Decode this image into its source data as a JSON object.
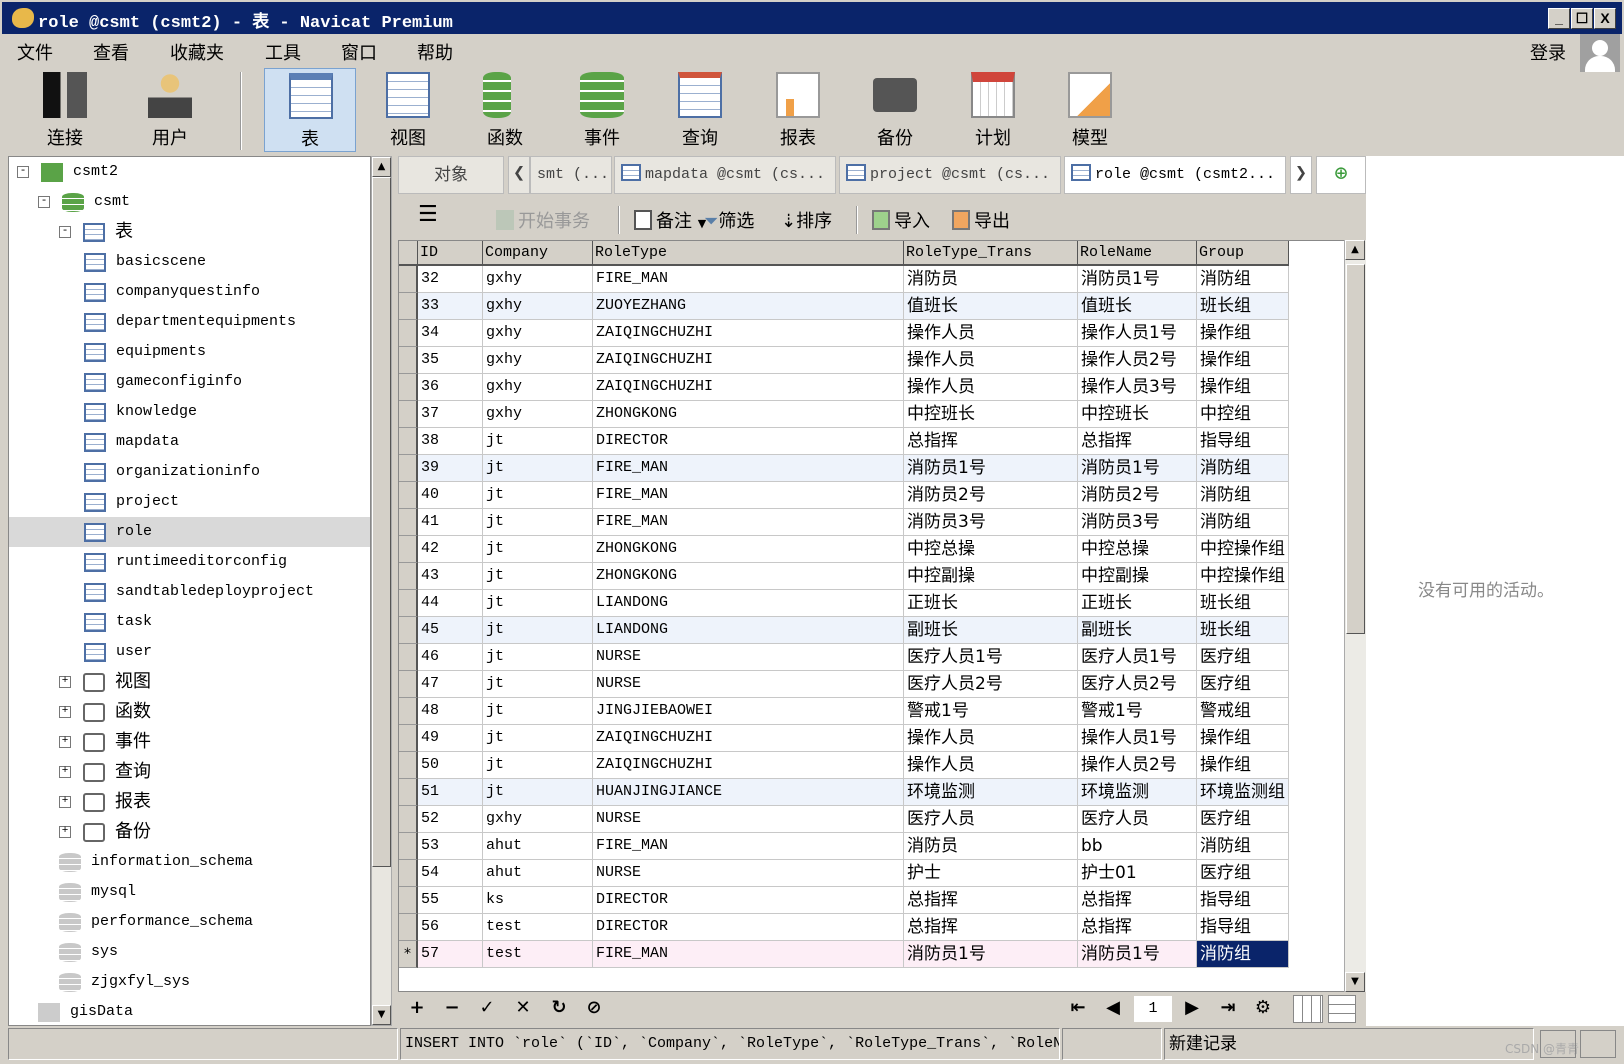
{
  "window": {
    "title": "role @csmt (csmt2) - 表 - Navicat Premium",
    "minimize": "_",
    "maximize": "☐",
    "close": "X"
  },
  "menu": [
    "文件",
    "查看",
    "收藏夹",
    "工具",
    "窗口",
    "帮助"
  ],
  "login": "登录",
  "toolbar": [
    {
      "label": "连接",
      "icon": "connection-icon"
    },
    {
      "label": "用户",
      "icon": "user-icon"
    },
    {
      "label": "表",
      "icon": "table-icon",
      "active": true
    },
    {
      "label": "视图",
      "icon": "view-icon"
    },
    {
      "label": "函数",
      "icon": "function-icon"
    },
    {
      "label": "事件",
      "icon": "event-icon"
    },
    {
      "label": "查询",
      "icon": "query-icon"
    },
    {
      "label": "报表",
      "icon": "report-icon"
    },
    {
      "label": "备份",
      "icon": "backup-icon"
    },
    {
      "label": "计划",
      "icon": "schedule-icon"
    },
    {
      "label": "模型",
      "icon": "model-icon"
    }
  ],
  "tree": {
    "connection": "csmt2",
    "database": "csmt",
    "tables_group": "表",
    "tables": [
      "basicscene",
      "companyquestinfo",
      "departmentequipments",
      "equipments",
      "gameconfiginfo",
      "knowledge",
      "mapdata",
      "organizationinfo",
      "project",
      "role",
      "runtimeeditorconfig",
      "sandtabledeployproject",
      "task",
      "user"
    ],
    "selected": "role",
    "groups": [
      "视图",
      "函数",
      "事件",
      "查询",
      "报表",
      "备份"
    ],
    "other_databases": [
      "information_schema",
      "mysql",
      "performance_schema",
      "sys",
      "zjgxfyl_sys"
    ],
    "other_connection": "gisData"
  },
  "tabs": {
    "objects": "对象",
    "items": [
      "smt (...",
      "mapdata @csmt (cs...",
      "project @csmt (cs...",
      "role @csmt (csmt2..."
    ],
    "active": 3
  },
  "subtoolbar": {
    "begin_transaction": "开始事务",
    "memo": "备注",
    "filter": "筛选",
    "sort": "排序",
    "import": "导入",
    "export": "导出"
  },
  "table": {
    "columns": [
      "ID",
      "Company",
      "RoleType",
      "RoleType_Trans",
      "RoleName",
      "Group"
    ],
    "rows": [
      [
        "32",
        "gxhy",
        "FIRE_MAN",
        "消防员",
        "消防员1号",
        "消防组"
      ],
      [
        "33",
        "gxhy",
        "ZUOYEZHANG",
        "值班长",
        "值班长",
        "班长组"
      ],
      [
        "34",
        "gxhy",
        "ZAIQINGCHUZHI",
        "操作人员",
        "操作人员1号",
        "操作组"
      ],
      [
        "35",
        "gxhy",
        "ZAIQINGCHUZHI",
        "操作人员",
        "操作人员2号",
        "操作组"
      ],
      [
        "36",
        "gxhy",
        "ZAIQINGCHUZHI",
        "操作人员",
        "操作人员3号",
        "操作组"
      ],
      [
        "37",
        "gxhy",
        "ZHONGKONG",
        "中控班长",
        "中控班长",
        "中控组"
      ],
      [
        "38",
        "jt",
        "DIRECTOR",
        "总指挥",
        "总指挥",
        "指导组"
      ],
      [
        "39",
        "jt",
        "FIRE_MAN",
        "消防员1号",
        "消防员1号",
        "消防组"
      ],
      [
        "40",
        "jt",
        "FIRE_MAN",
        "消防员2号",
        "消防员2号",
        "消防组"
      ],
      [
        "41",
        "jt",
        "FIRE_MAN",
        "消防员3号",
        "消防员3号",
        "消防组"
      ],
      [
        "42",
        "jt",
        "ZHONGKONG",
        "中控总操",
        "中控总操",
        "中控操作组"
      ],
      [
        "43",
        "jt",
        "ZHONGKONG",
        "中控副操",
        "中控副操",
        "中控操作组"
      ],
      [
        "44",
        "jt",
        "LIANDONG",
        "正班长",
        "正班长",
        "班长组"
      ],
      [
        "45",
        "jt",
        "LIANDONG",
        "副班长",
        "副班长",
        "班长组"
      ],
      [
        "46",
        "jt",
        "NURSE",
        "医疗人员1号",
        "医疗人员1号",
        "医疗组"
      ],
      [
        "47",
        "jt",
        "NURSE",
        "医疗人员2号",
        "医疗人员2号",
        "医疗组"
      ],
      [
        "48",
        "jt",
        "JINGJIEBAOWEI",
        "警戒1号",
        "警戒1号",
        "警戒组"
      ],
      [
        "49",
        "jt",
        "ZAIQINGCHUZHI",
        "操作人员",
        "操作人员1号",
        "操作组"
      ],
      [
        "50",
        "jt",
        "ZAIQINGCHUZHI",
        "操作人员",
        "操作人员2号",
        "操作组"
      ],
      [
        "51",
        "jt",
        "HUANJINGJIANCE",
        "环境监测",
        "环境监测",
        "环境监测组"
      ],
      [
        "52",
        "gxhy",
        "NURSE",
        "医疗人员",
        "医疗人员",
        "医疗组"
      ],
      [
        "53",
        "ahut",
        "FIRE_MAN",
        "消防员",
        "bb",
        "消防组"
      ],
      [
        "54",
        "ahut",
        "NURSE",
        "护士",
        "护士01",
        "医疗组"
      ],
      [
        "55",
        "ks",
        "DIRECTOR",
        "总指挥",
        "总指挥",
        "指导组"
      ],
      [
        "56",
        "test",
        "DIRECTOR",
        "总指挥",
        "总指挥",
        "指导组"
      ],
      [
        "57",
        "test",
        "FIRE_MAN",
        "消防员1号",
        "消防员1号",
        "消防组"
      ]
    ],
    "new_row_marker": "*"
  },
  "bottom_toolbar": {
    "add": "+",
    "delete": "−",
    "apply": "✓",
    "discard": "✕",
    "refresh": "↻",
    "stop": "⊘",
    "first": "⇤",
    "prev": "◀",
    "page": "1",
    "next": "▶",
    "last": "⇥",
    "settings": "⚙"
  },
  "right_panel": {
    "message": "没有可用的活动。"
  },
  "status": {
    "sql": "INSERT INTO `role` (`ID`, `Company`, `RoleType`, `RoleType_Trans`, `RoleName`, `Group`",
    "record": "新建记录"
  },
  "watermark": "CSDN @青青",
  "colors": {
    "titlebar": "#0a246a",
    "selection": "#0a246a",
    "new_row": "#fdeef6",
    "alt_row": "#eef3fb"
  }
}
